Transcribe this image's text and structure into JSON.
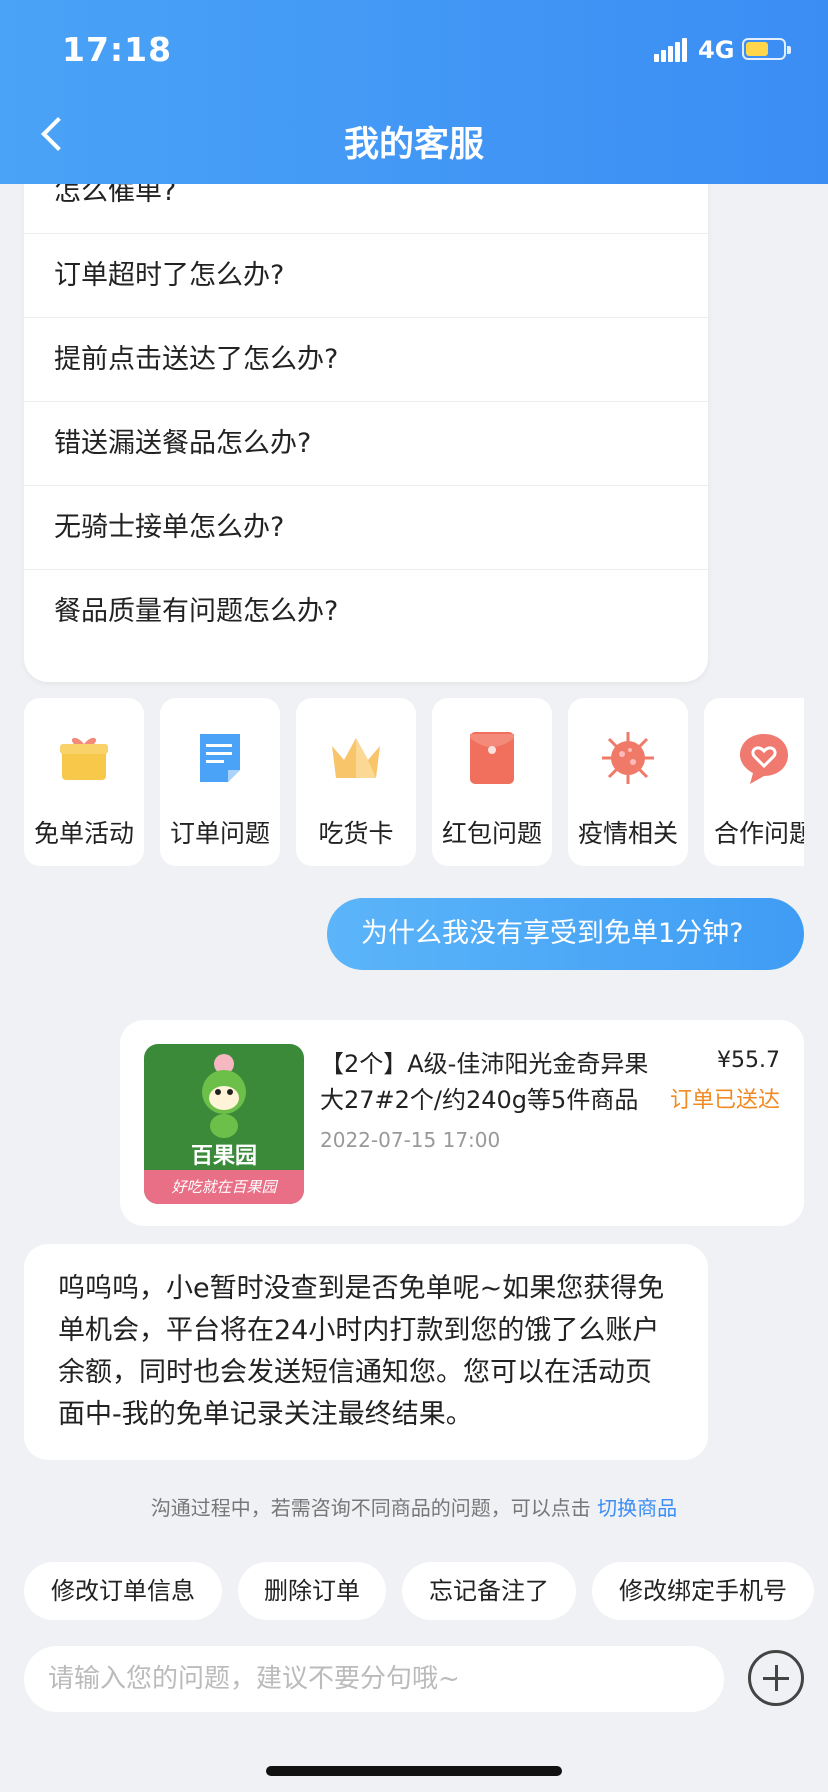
{
  "status_bar": {
    "time": "17:18",
    "network": "4G"
  },
  "header": {
    "title": "我的客服"
  },
  "faq": [
    "怎么催单?",
    "订单超时了怎么办?",
    "提前点击送达了怎么办?",
    "错送漏送餐品怎么办?",
    "无骑士接单怎么办?",
    "餐品质量有问题怎么办?"
  ],
  "categories": [
    {
      "label": "免单活动",
      "icon": "gift-icon",
      "color": "#f7c84a"
    },
    {
      "label": "订单问题",
      "icon": "document-icon",
      "color": "#4aa3f6"
    },
    {
      "label": "吃货卡",
      "icon": "crown-icon",
      "color": "#f8c56b"
    },
    {
      "label": "红包问题",
      "icon": "red-envelope-icon",
      "color": "#f0705d"
    },
    {
      "label": "疫情相关",
      "icon": "virus-icon",
      "color": "#f07a68"
    },
    {
      "label": "合作问题",
      "icon": "chat-heart-icon",
      "color": "#f07a70"
    }
  ],
  "messages": {
    "user_message": "为什么我没有享受到免单1分钟?",
    "order": {
      "name": "【2个】A级-佳沛阳光金奇异果大27#2个/约240g等5件商品",
      "date": "2022-07-15 17:00",
      "price": "¥55.7",
      "status": "订单已送达",
      "brand": "百果园",
      "slogan": "好吃就在百果园"
    },
    "bot_reply": "呜呜呜，小e暂时没查到是否免单呢~如果您获得免单机会，平台将在24小时内打款到您的饿了么账户余额，同时也会发送短信通知您。您可以在活动页面中-我的免单记录关注最终结果。"
  },
  "hint": {
    "text": "沟通过程中，若需咨询不同商品的问题，可以点击",
    "link": "切换商品"
  },
  "quick_actions": [
    "修改订单信息",
    "删除订单",
    "忘记备注了",
    "修改绑定手机号"
  ],
  "input": {
    "placeholder": "请输入您的问题，建议不要分句哦~"
  }
}
